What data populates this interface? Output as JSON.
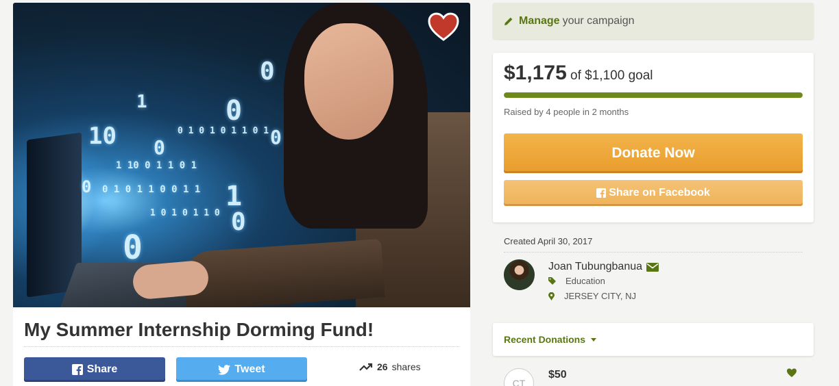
{
  "campaign": {
    "title": "My Summer Internship Dorming Fund!"
  },
  "social": {
    "share_label": "Share",
    "tweet_label": "Tweet",
    "shares_number": "26",
    "shares_label": "shares"
  },
  "manage": {
    "strong": "Manage",
    "rest": "your campaign"
  },
  "funding": {
    "raised": "$1,175",
    "goal_text": "of $1,100 goal",
    "progress_fraction": 1.0,
    "raised_by": "Raised by 4 people in 2 months",
    "donate_label": "Donate Now",
    "share_facebook_label": "Share on Facebook"
  },
  "organizer": {
    "created": "Created April 30, 2017",
    "name": "Joan Tubungbanua",
    "category": "Education",
    "location": "JERSEY CITY, NJ"
  },
  "donations": {
    "header": "Recent Donations",
    "items": [
      {
        "initials": "CT",
        "amount": "$50"
      }
    ]
  },
  "icons": {
    "heart": "heart-icon",
    "pencil": "pencil-icon",
    "facebook": "facebook-icon",
    "twitter": "twitter-icon",
    "trend": "trending-up-icon",
    "envelope": "envelope-icon",
    "tag": "tag-icon",
    "map_pin": "map-pin-icon"
  },
  "colors": {
    "accent_green": "#5a7614",
    "progress_green": "#6e8a1c",
    "donate_orange": "#f2b44a",
    "facebook_blue": "#3b5998",
    "twitter_blue": "#55acee",
    "heart_red": "#c0392b"
  }
}
